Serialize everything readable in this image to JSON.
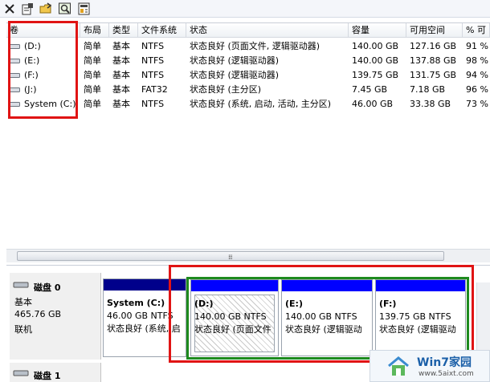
{
  "toolbar": {
    "icons": [
      "close-icon",
      "properties-icon",
      "open-folder-icon",
      "search-icon",
      "help-icon"
    ]
  },
  "list": {
    "headers": [
      "卷",
      "布局",
      "类型",
      "文件系统",
      "状态",
      "容量",
      "可用空间",
      "% 可"
    ],
    "rows": [
      {
        "volume": "(D:)",
        "layout": "简单",
        "type": "基本",
        "fs": "NTFS",
        "status": "状态良好 (页面文件, 逻辑驱动器)",
        "capacity": "140.00 GB",
        "free": "127.16 GB",
        "pct": "91 %"
      },
      {
        "volume": "(E:)",
        "layout": "简单",
        "type": "基本",
        "fs": "NTFS",
        "status": "状态良好 (逻辑驱动器)",
        "capacity": "140.00 GB",
        "free": "137.88 GB",
        "pct": "98 %"
      },
      {
        "volume": "(F:)",
        "layout": "简单",
        "type": "基本",
        "fs": "NTFS",
        "status": "状态良好 (逻辑驱动器)",
        "capacity": "139.75 GB",
        "free": "131.75 GB",
        "pct": "94 %"
      },
      {
        "volume": "(J:)",
        "layout": "简单",
        "type": "基本",
        "fs": "FAT32",
        "status": "状态良好 (主分区)",
        "capacity": "7.45 GB",
        "free": "7.18 GB",
        "pct": "96 %"
      },
      {
        "volume": "System (C:)",
        "layout": "简单",
        "type": "基本",
        "fs": "NTFS",
        "status": "状态良好 (系统, 启动, 活动, 主分区)",
        "capacity": "46.00 GB",
        "free": "33.38 GB",
        "pct": "73 %"
      }
    ]
  },
  "scrollbar": {
    "grip": "⁞⁞⁞"
  },
  "disks": [
    {
      "name": "磁盘 0",
      "kind": "基本",
      "size": "465.76 GB",
      "state": "联机"
    },
    {
      "name": "磁盘 1"
    }
  ],
  "partitions": [
    {
      "name": "System  (C:)",
      "size": "46.00 GB NTFS",
      "status": "状态良好 (系统, 启"
    },
    {
      "name": "(D:)",
      "size": "140.00 GB NTFS",
      "status": "状态良好 (页面文件"
    },
    {
      "name": "(E:)",
      "size": "140.00 GB NTFS",
      "status": "状态良好 (逻辑驱动"
    },
    {
      "name": "(F:)",
      "size": "139.75 GB NTFS",
      "status": "状态良好 (逻辑驱动"
    }
  ],
  "watermark": {
    "title": "Win7家园",
    "url": "www.5aixt.com"
  },
  "colors": {
    "primary_bar": "#00008b",
    "logical_bar": "#0000ff",
    "highlight_red": "#e01414",
    "highlight_green": "#1e8a1e"
  }
}
